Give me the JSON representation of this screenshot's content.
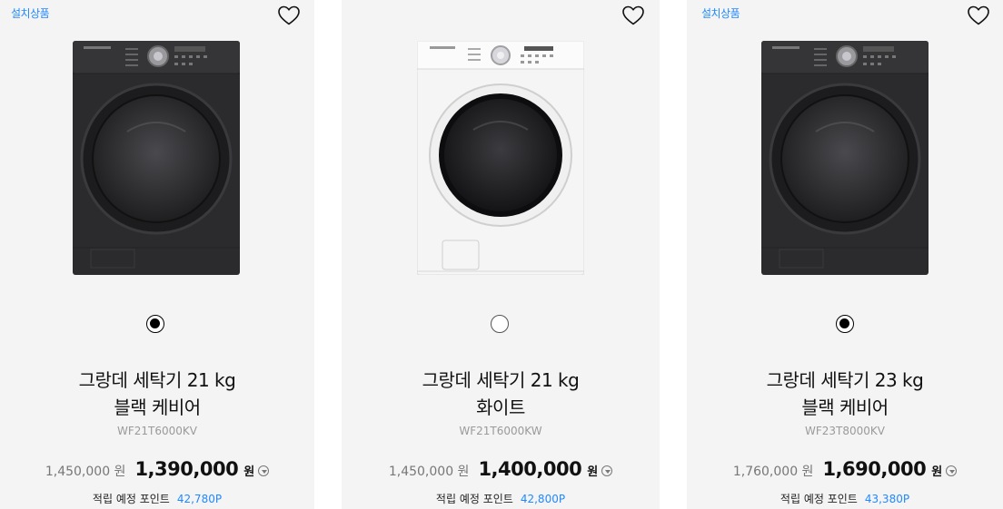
{
  "accent_color": "#2189ff",
  "products": [
    {
      "badge": "설치상품",
      "name_line1": "그랑데 세탁기 21 kg",
      "name_line2": "블랙 케비어",
      "model": "WF21T6000KV",
      "original_price": "1,450,000 원",
      "sale_price": "1,390,000",
      "currency": "원",
      "points_label": "적립 예정 포인트",
      "points_value": "42,780P",
      "color_swatch": "black",
      "body_color": "#2b2b2d",
      "icon": "heart-icon"
    },
    {
      "badge": "",
      "name_line1": "그랑데 세탁기 21 kg",
      "name_line2": "화이트",
      "model": "WF21T6000KW",
      "original_price": "1,450,000 원",
      "sale_price": "1,400,000",
      "currency": "원",
      "points_label": "적립 예정 포인트",
      "points_value": "42,800P",
      "color_swatch": "white",
      "body_color": "#f5f5f5",
      "icon": "heart-icon"
    },
    {
      "badge": "설치상품",
      "name_line1": "그랑데 세탁기 23 kg",
      "name_line2": "블랙 케비어",
      "model": "WF23T8000KV",
      "original_price": "1,760,000 원",
      "sale_price": "1,690,000",
      "currency": "원",
      "points_label": "적립 예정 포인트",
      "points_value": "43,380P",
      "color_swatch": "black",
      "body_color": "#2b2b2d",
      "icon": "heart-icon"
    }
  ]
}
